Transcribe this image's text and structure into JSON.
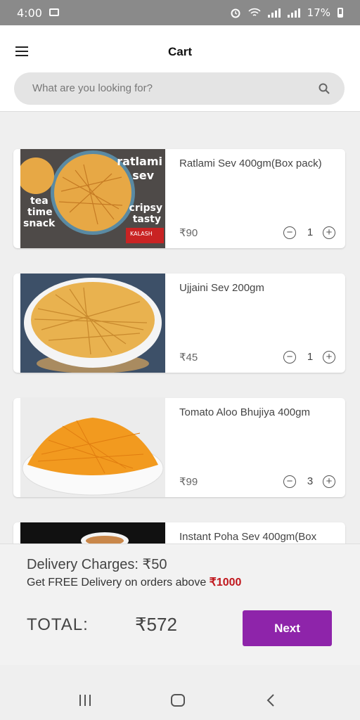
{
  "status_bar": {
    "time": "4:00",
    "battery": "17%"
  },
  "header": {
    "title": "Cart"
  },
  "search": {
    "placeholder": "What are you looking for?"
  },
  "cart_items": [
    {
      "name": "Ratlami Sev 400gm(Box pack)",
      "price": "₹90",
      "quantity": "1",
      "image_text": {
        "top_right": "ratlami",
        "top_right2": "sev",
        "left1": "tea",
        "left2": "time",
        "left3": "snack",
        "right1": "cripsy",
        "right2": "tasty",
        "brand": "KALASH"
      }
    },
    {
      "name": "Ujjaini Sev 200gm",
      "price": "₹45",
      "quantity": "1"
    },
    {
      "name": "Tomato Aloo Bhujiya 400gm",
      "price": "₹99",
      "quantity": "3"
    },
    {
      "name": "Instant Poha Sev 400gm(Box"
    }
  ],
  "footer": {
    "delivery_charges": "Delivery Charges: ₹50",
    "free_delivery_text": "Get FREE Delivery on orders above ",
    "free_delivery_amount": "₹1000",
    "total_label": "TOTAL:",
    "total_value": "₹572",
    "next_label": "Next"
  },
  "colors": {
    "accent": "#8e24aa",
    "highlight": "#c0171d"
  }
}
